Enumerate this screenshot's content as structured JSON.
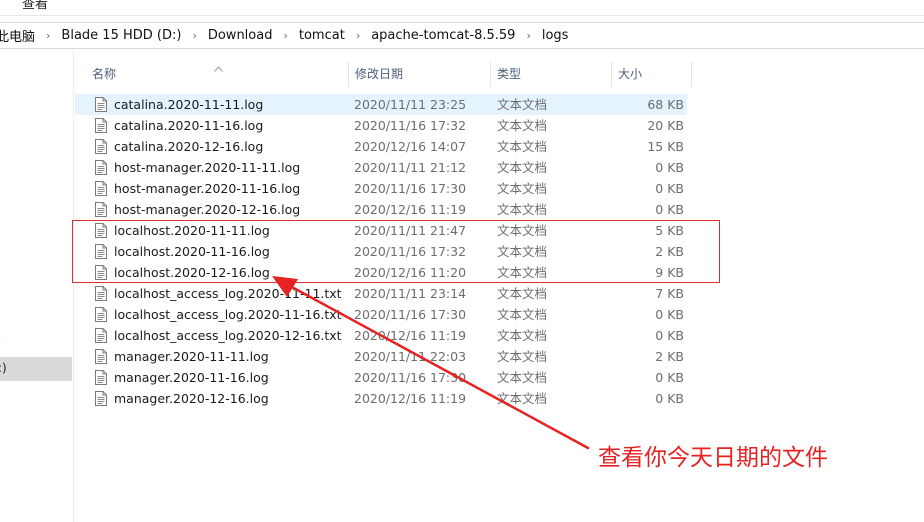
{
  "ribbon": {
    "tab_label": "查看"
  },
  "breadcrumb": {
    "items": [
      "此电脑",
      "Blade 15 HDD (D:)",
      "Download",
      "tomcat",
      "apache-tomcat-8.5.59",
      "logs"
    ],
    "separator": "›"
  },
  "nav": {
    "selected_item_label": ":)",
    "expander_glyph": "›"
  },
  "columns": {
    "name": "名称",
    "modified": "修改日期",
    "type": "类型",
    "size": "大小"
  },
  "files": [
    {
      "name": "catalina.2020-11-11.log",
      "modified": "2020/11/11 23:25",
      "type": "文本文档",
      "size": "68 KB",
      "selected": true
    },
    {
      "name": "catalina.2020-11-16.log",
      "modified": "2020/11/16 17:32",
      "type": "文本文档",
      "size": "20 KB"
    },
    {
      "name": "catalina.2020-12-16.log",
      "modified": "2020/12/16 14:07",
      "type": "文本文档",
      "size": "15 KB"
    },
    {
      "name": "host-manager.2020-11-11.log",
      "modified": "2020/11/11 21:12",
      "type": "文本文档",
      "size": "0 KB"
    },
    {
      "name": "host-manager.2020-11-16.log",
      "modified": "2020/11/16 17:30",
      "type": "文本文档",
      "size": "0 KB"
    },
    {
      "name": "host-manager.2020-12-16.log",
      "modified": "2020/12/16 11:19",
      "type": "文本文档",
      "size": "0 KB"
    },
    {
      "name": "localhost.2020-11-11.log",
      "modified": "2020/11/11 21:47",
      "type": "文本文档",
      "size": "5 KB"
    },
    {
      "name": "localhost.2020-11-16.log",
      "modified": "2020/11/16 17:32",
      "type": "文本文档",
      "size": "2 KB"
    },
    {
      "name": "localhost.2020-12-16.log",
      "modified": "2020/12/16 11:20",
      "type": "文本文档",
      "size": "9 KB"
    },
    {
      "name": "localhost_access_log.2020-11-11.txt",
      "modified": "2020/11/11 23:14",
      "type": "文本文档",
      "size": "7 KB"
    },
    {
      "name": "localhost_access_log.2020-11-16.txt",
      "modified": "2020/11/16 17:30",
      "type": "文本文档",
      "size": "0 KB"
    },
    {
      "name": "localhost_access_log.2020-12-16.txt",
      "modified": "2020/12/16 11:19",
      "type": "文本文档",
      "size": "0 KB"
    },
    {
      "name": "manager.2020-11-11.log",
      "modified": "2020/11/11 22:03",
      "type": "文本文档",
      "size": "2 KB"
    },
    {
      "name": "manager.2020-11-16.log",
      "modified": "2020/11/16 17:30",
      "type": "文本文档",
      "size": "0 KB"
    },
    {
      "name": "manager.2020-12-16.log",
      "modified": "2020/12/16 11:19",
      "type": "文本文档",
      "size": "0 KB"
    }
  ],
  "annotation": {
    "callout_text": "查看你今天日期的文件",
    "color": "#e62222"
  },
  "colors": {
    "selected_row": "#e5f3ff",
    "header_text": "#4c607a",
    "secondary_text": "#6d6d6d"
  },
  "icons": {
    "file": "text-file-icon",
    "sort": "sort-up-icon"
  }
}
